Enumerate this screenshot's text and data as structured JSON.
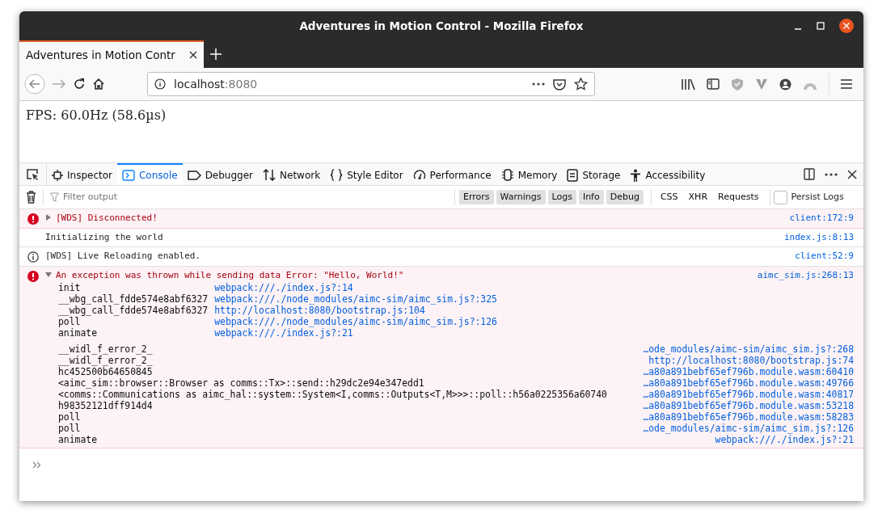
{
  "window": {
    "title": "Adventures in Motion Control - Mozilla Firefox"
  },
  "tabs": [
    {
      "label": "Adventures in Motion Contr",
      "selected": true
    }
  ],
  "address": {
    "host": "localhost",
    "port": ":8080"
  },
  "page": {
    "text": "FPS: 60.0Hz (58.6µs)"
  },
  "devtools": {
    "tabs": [
      {
        "label": "Inspector",
        "selected": false
      },
      {
        "label": "Console",
        "selected": true
      },
      {
        "label": "Debugger",
        "selected": false
      },
      {
        "label": "Network",
        "selected": false
      },
      {
        "label": "Style Editor",
        "selected": false
      },
      {
        "label": "Performance",
        "selected": false
      },
      {
        "label": "Memory",
        "selected": false
      },
      {
        "label": "Storage",
        "selected": false
      },
      {
        "label": "Accessibility",
        "selected": false
      }
    ],
    "filter": {
      "placeholder": "Filter output"
    },
    "levels": [
      {
        "label": "Errors",
        "selected": true
      },
      {
        "label": "Warnings",
        "selected": true
      },
      {
        "label": "Logs",
        "selected": true
      },
      {
        "label": "Info",
        "selected": true
      },
      {
        "label": "Debug",
        "selected": true
      }
    ],
    "categories": [
      {
        "label": "CSS",
        "selected": false
      },
      {
        "label": "XHR",
        "selected": false
      },
      {
        "label": "Requests",
        "selected": false
      }
    ],
    "persist_logs": {
      "label": "Persist Logs",
      "checked": false
    },
    "messages": [
      {
        "kind": "error",
        "text": "[WDS] Disconnected!",
        "expanded": false,
        "location": "client:172:9"
      },
      {
        "kind": "log",
        "text": "Initializing the world",
        "location": "index.js:8:13"
      },
      {
        "kind": "info",
        "text": "[WDS] Live Reloading enabled.",
        "location": "client:52:9"
      },
      {
        "kind": "error",
        "text": "An exception was thrown while sending data Error: \"Hello, World!\"",
        "expanded": true,
        "location": "aimc_sim.js:268:13",
        "stacks": [
          {
            "kind": "columns",
            "frames": [
              {
                "function": "init",
                "source": "webpack:///./index.js?:14"
              },
              {
                "function": "__wbg_call_fdde574e8abf6327",
                "source": "webpack:///./node_modules/aimc-sim/aimc_sim.js?:325"
              },
              {
                "function": "__wbg_call_fdde574e8abf6327",
                "source": "http://localhost:8080/bootstrap.js:104"
              },
              {
                "function": "poll",
                "source": "webpack:///./node_modules/aimc-sim/aimc_sim.js?:126"
              },
              {
                "function": "animate",
                "source": "webpack:///./index.js?:21"
              }
            ]
          },
          {
            "kind": "right",
            "frames": [
              {
                "function": "__widl_f_error_2_",
                "source": "…ode_modules/aimc-sim/aimc_sim.js?:268"
              },
              {
                "function": "__widl_f_error_2_",
                "source": "http://localhost:8080/bootstrap.js:74"
              },
              {
                "function": "hc452500b64650845",
                "source": "…a80a891bebf65ef796b.module.wasm:60410"
              },
              {
                "function": "<aimc_sim::browser::Browser as comms::Tx>::send::h29dc2e94e347edd1",
                "source": "…a80a891bebf65ef796b.module.wasm:49766"
              },
              {
                "function": "<comms::Communications as aimc_hal::system::System<I,comms::Outputs<T,M>>>::poll::h56a0225356a60740",
                "source": "…a80a891bebf65ef796b.module.wasm:40817"
              },
              {
                "function": "h98352121dff914d4",
                "source": "…a80a891bebf65ef796b.module.wasm:53218"
              },
              {
                "function": "poll",
                "source": "…a80a891bebf65ef796b.module.wasm:58283"
              },
              {
                "function": "poll",
                "source": "…ode_modules/aimc-sim/aimc_sim.js?:126"
              },
              {
                "function": "animate",
                "source": "webpack:///./index.js?:21"
              }
            ]
          }
        ]
      }
    ]
  }
}
